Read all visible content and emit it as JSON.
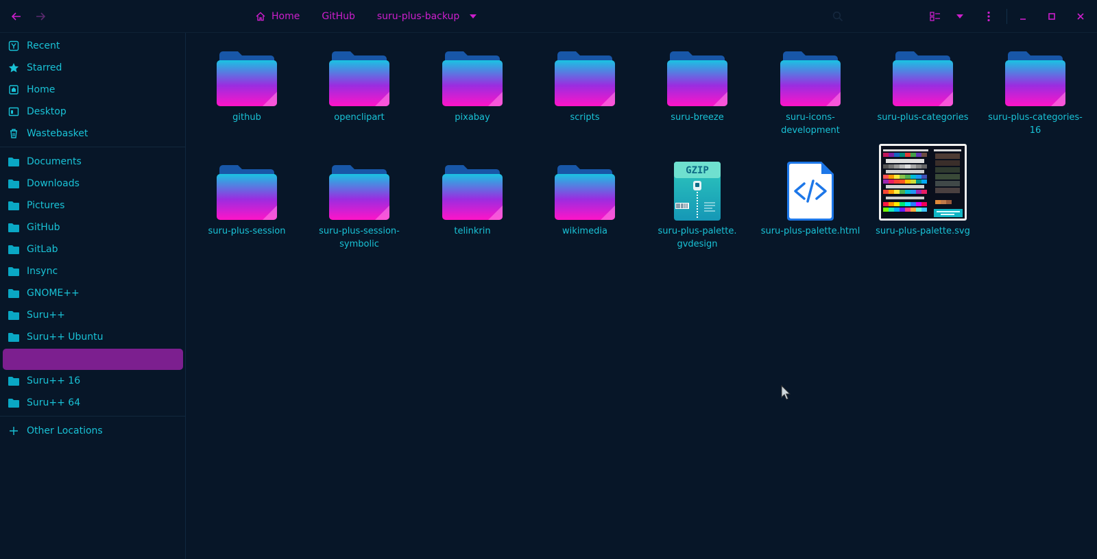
{
  "header": {
    "breadcrumbs": [
      "Home",
      "GitHub",
      "suru-plus-backup"
    ],
    "icons": [
      "back-arrow-icon",
      "forward-arrow-icon",
      "home-icon",
      "chevron-down-icon",
      "search-icon",
      "view-list-icon",
      "kebab-menu-icon",
      "minimize-icon",
      "maximize-icon",
      "close-icon"
    ]
  },
  "sidebar": {
    "items": [
      {
        "label": "Recent",
        "icon": "recent-icon"
      },
      {
        "label": "Starred",
        "icon": "star-icon"
      },
      {
        "label": "Home",
        "icon": "home-icon"
      },
      {
        "label": "Desktop",
        "icon": "desktop-icon"
      },
      {
        "label": "Wastebasket",
        "icon": "trash-icon"
      },
      {
        "label": "Documents",
        "icon": "folder-icon"
      },
      {
        "label": "Downloads",
        "icon": "folder-icon"
      },
      {
        "label": "Pictures",
        "icon": "folder-icon"
      },
      {
        "label": "GitHub",
        "icon": "folder-icon"
      },
      {
        "label": "GitLab",
        "icon": "folder-icon"
      },
      {
        "label": "Insync",
        "icon": "folder-icon"
      },
      {
        "label": "GNOME++",
        "icon": "folder-icon"
      },
      {
        "label": "Suru++",
        "icon": "folder-icon"
      },
      {
        "label": "Suru++ Ubuntu",
        "icon": "folder-icon"
      },
      {
        "label": "",
        "icon": "folder-icon"
      },
      {
        "label": "Suru++ 16",
        "icon": "folder-icon"
      },
      {
        "label": "Suru++ 64",
        "icon": "folder-icon"
      }
    ],
    "other_locations": "Other Locations"
  },
  "files": [
    {
      "name": "github",
      "type": "folder"
    },
    {
      "name": "openclipart",
      "type": "folder"
    },
    {
      "name": "pixabay",
      "type": "folder"
    },
    {
      "name": "scripts",
      "type": "folder"
    },
    {
      "name": "suru-breeze",
      "type": "folder"
    },
    {
      "name": "suru-icons-\ndevelopment",
      "type": "folder"
    },
    {
      "name": "suru-plus-categories",
      "type": "folder"
    },
    {
      "name": "suru-plus-categories-\n16",
      "type": "folder"
    },
    {
      "name": "suru-plus-session",
      "type": "folder"
    },
    {
      "name": "suru-plus-session-\nsymbolic",
      "type": "folder"
    },
    {
      "name": "telinkrin",
      "type": "folder"
    },
    {
      "name": "wikimedia",
      "type": "folder"
    },
    {
      "name": "suru-plus-palette.\ngvdesign",
      "type": "gzip"
    },
    {
      "name": "suru-plus-palette.html",
      "type": "html"
    },
    {
      "name": "suru-plus-palette.svg",
      "type": "svg-image"
    }
  ],
  "gzip_badge": "GZIP",
  "colors": {
    "background": "#071628",
    "accent_text": "#19c2d6",
    "breadcrumb": "#cc1fcc",
    "active_item": "#7c1f8f"
  }
}
